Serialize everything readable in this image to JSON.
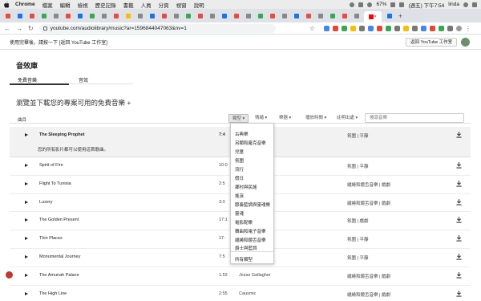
{
  "menubar": {
    "app_name": "Chrome",
    "items": [
      "檔案",
      "編輯",
      "檢視",
      "歷史記錄",
      "書籤",
      "人員",
      "分頁",
      "視窗",
      "說明"
    ],
    "battery": "67%",
    "datetime": "(週五) 下午7:54",
    "user": "linda"
  },
  "browser": {
    "url": "youtube.com/audiolibrary/music?ar=1596844047063&nv=1"
  },
  "notice": {
    "text": "使用完畢後，請按一下 [返回 YouTube 工作室]",
    "return_button": "返回 YouTube 工作室"
  },
  "library": {
    "title": "音效庫",
    "tabs": [
      "免費音樂",
      "音效"
    ],
    "subtitle": "瀏覽並下載您的專案可用的免費音樂",
    "subtitle_suffix": "+"
  },
  "filters": {
    "track_label": "曲目",
    "buttons": [
      "類型",
      "情緒",
      "樂器",
      "播放時間",
      "註明出處"
    ],
    "search_placeholder": "搜尋音樂"
  },
  "tracks": [
    {
      "title": "The Sleeping Prophet",
      "duration": "7:4",
      "artist": "",
      "genre": "氛圍 | 平靜",
      "note": "您的所有影片都可以使用這首歌曲。"
    },
    {
      "title": "Spirit of Fire",
      "duration": "10:0",
      "artist": "",
      "genre": "氛圍 | 平靜"
    },
    {
      "title": "Flight To Tunisia",
      "duration": "2:5",
      "artist": "",
      "genre": "繾綣和鏡舌音樂 | 戲劇"
    },
    {
      "title": "Luxery",
      "duration": "3:0",
      "artist": "",
      "genre": "繾綣和鏡舌音樂 | 戲劇"
    },
    {
      "title": "The Golden Present",
      "duration": "17:1",
      "artist": "",
      "genre": "氛圍 | 戲劇"
    },
    {
      "title": "Thin Places",
      "duration": "17:",
      "artist": "",
      "genre": "氛圍 | 平靜"
    },
    {
      "title": "Monumental Journey",
      "duration": "7:5",
      "artist": "",
      "genre": "氛圍 | 平靜"
    },
    {
      "title": "The Amunah Palace",
      "duration": "1:52",
      "artist": "Jesse Gallagher",
      "genre": "繾綣和鏡舌音樂 | 戲劇"
    },
    {
      "title": "The High Line",
      "duration": "2:55",
      "artist": "Causmic",
      "genre": "繾綣和鏡舌音樂 | 戲劇"
    }
  ],
  "genre_dropdown": {
    "items": [
      "古典樂",
      "另類和龐克音樂",
      "兒童",
      "氛圍",
      "流行",
      "假日",
      "鄉村與民謠",
      "搖滾",
      "節奏藍調與靈魂樂",
      "靈魂",
      "電影配樂",
      "舞曲和電子音樂",
      "繾綣和鏡舌音樂",
      "爵士與藍調"
    ],
    "all_label": "所有類型"
  }
}
